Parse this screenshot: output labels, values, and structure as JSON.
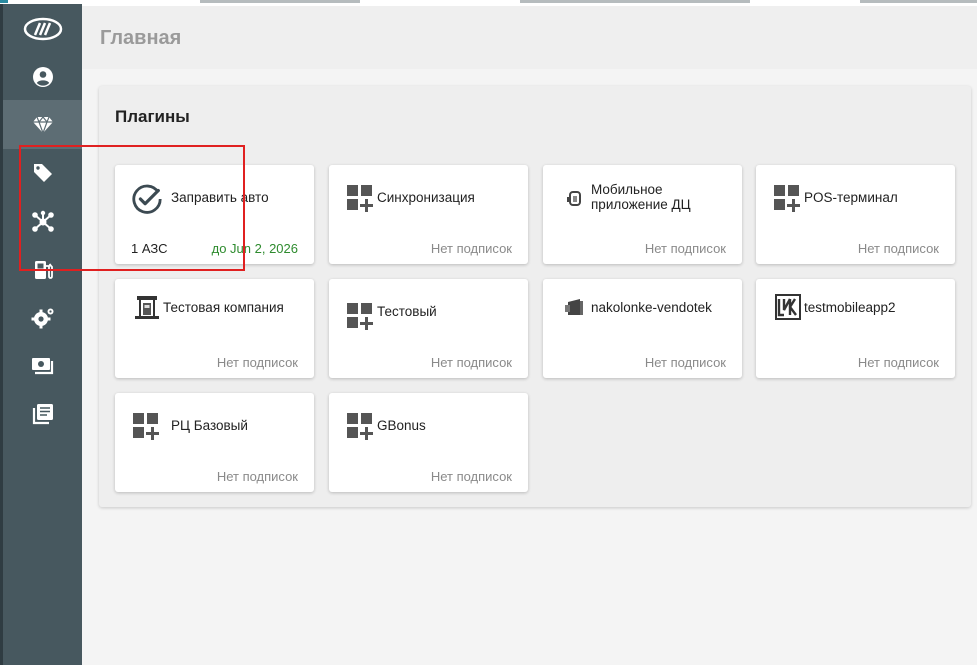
{
  "page": {
    "title": "Главная"
  },
  "panel": {
    "title": "Плагины"
  },
  "sidebar": {
    "items": [
      {
        "icon": "logo-icon"
      },
      {
        "icon": "account-icon"
      },
      {
        "icon": "diamond-icon"
      },
      {
        "icon": "tag-icon"
      },
      {
        "icon": "network-icon"
      },
      {
        "icon": "fuel-pump-icon"
      },
      {
        "icon": "settings-icon"
      },
      {
        "icon": "cash-icon"
      },
      {
        "icon": "library-icon"
      }
    ]
  },
  "plugins": [
    {
      "name": "Заправить авто",
      "count": "1 АЗС",
      "expiry": "до Jun 2, 2026",
      "icon": "check-circle-icon"
    },
    {
      "name": "Синхронизация",
      "status": "Нет подписок",
      "icon": "widgets-add-icon"
    },
    {
      "name": "Мобильное приложение ДЦ",
      "status": "Нет подписок",
      "icon": "mobile-app-icon"
    },
    {
      "name": "POS-терминал",
      "status": "Нет подписок",
      "icon": "widgets-add-icon"
    },
    {
      "name": "Тестовая компания",
      "status": "Нет подписок",
      "icon": "gas-station-icon"
    },
    {
      "name": "Тестовый",
      "status": "Нет подписок",
      "icon": "widgets-add-icon"
    },
    {
      "name": "nakolonke-vendotek",
      "status": "Нет подписок",
      "icon": "terminal-device-icon"
    },
    {
      "name": "testmobileapp2",
      "status": "Нет подписок",
      "icon": "lukoil-logo-icon"
    },
    {
      "name": "РЦ Базовый",
      "status": "Нет подписок",
      "icon": "widgets-add-icon"
    },
    {
      "name": "GBonus",
      "status": "Нет подписок",
      "icon": "widgets-add-icon"
    }
  ]
}
